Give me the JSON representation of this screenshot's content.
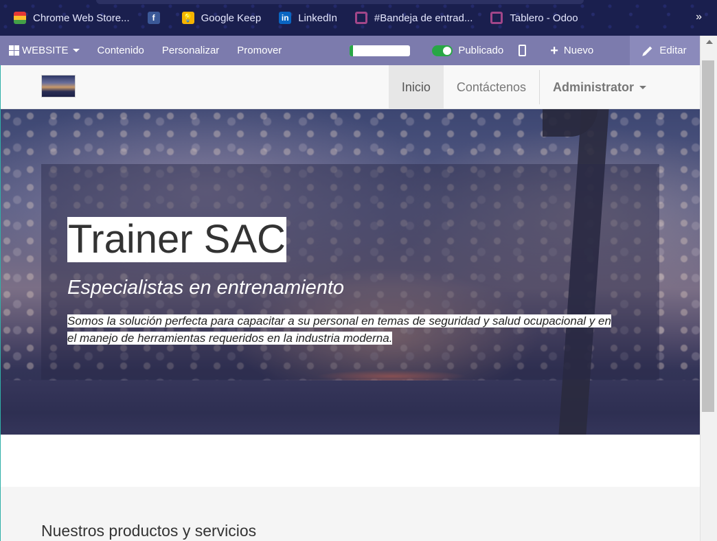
{
  "bookmarks": [
    {
      "label": "Chrome Web Store...",
      "icon": "chrome-web-store-icon"
    },
    {
      "label": "",
      "icon": "facebook-icon"
    },
    {
      "label": "Google Keep",
      "icon": "google-keep-icon"
    },
    {
      "label": "LinkedIn",
      "icon": "linkedin-icon"
    },
    {
      "label": "#Bandeja de entrad...",
      "icon": "odoo-icon"
    },
    {
      "label": "Tablero - Odoo",
      "icon": "odoo-icon"
    }
  ],
  "bookmarks_more": "»",
  "adminbar": {
    "website_label": "WEBSITE",
    "content_label": "Contenido",
    "customize_label": "Personalizar",
    "promote_label": "Promover",
    "progress": 0.05,
    "published_label": "Publicado",
    "new_label": "Nuevo",
    "edit_label": "Editar",
    "accent": "#7c7bad"
  },
  "navbar": {
    "links": [
      "Inicio",
      "Contáctenos"
    ],
    "active": "Inicio",
    "user": "Administrator"
  },
  "hero": {
    "title": "Trainer SAC",
    "subtitle": "Especialistas en entrenamiento",
    "text_line1": "Somos la solución perfecta para capacitar a su personal en temas de seguridad y salud ocupacional y en",
    "text_line2": "el manejo de herramientas requeridos en la industria moderna."
  },
  "products": {
    "heading": "Nuestros productos y servicios"
  }
}
